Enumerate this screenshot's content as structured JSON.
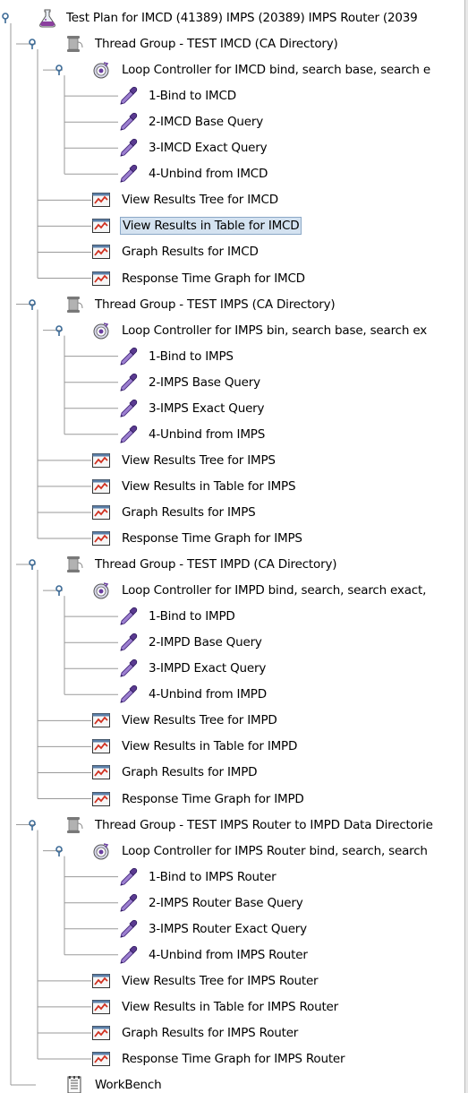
{
  "tree": {
    "root": {
      "label": "Test Plan for IMCD (41389) IMPS  (20389)  IMPS Router (2039",
      "icon": "flask-icon"
    },
    "groups": [
      {
        "label": "Thread Group - TEST IMCD (CA Directory)",
        "loop": "Loop Controller for IMCD bind, search base, search e",
        "samplers": [
          "1-Bind to IMCD",
          "2-IMCD Base Query",
          "3-IMCD Exact Query",
          "4-Unbind from IMCD"
        ],
        "listeners": [
          "View Results Tree for IMCD",
          "View Results in Table for IMCD",
          "Graph Results for IMCD",
          "Response Time Graph for IMCD"
        ]
      },
      {
        "label": "Thread Group - TEST IMPS (CA Directory)",
        "loop": "Loop Controller for IMPS bin, search base, search ex",
        "samplers": [
          "1-Bind to IMPS",
          "2-IMPS Base Query",
          "3-IMPS Exact Query",
          "4-Unbind from IMPS"
        ],
        "listeners": [
          "View Results Tree for IMPS",
          "View Results in Table for IMPS",
          "Graph Results for IMPS",
          "Response Time Graph for IMPS"
        ]
      },
      {
        "label": "Thread Group - TEST IMPD (CA Directory)",
        "loop": "Loop Controller for IMPD bind, search, search exact,",
        "samplers": [
          "1-Bind to IMPD",
          "2-IMPD Base Query",
          "3-IMPD Exact Query",
          "4-Unbind from IMPD"
        ],
        "listeners": [
          "View Results Tree for IMPD",
          "View Results in Table for IMPD",
          "Graph Results for IMPD",
          "Response Time Graph for IMPD"
        ]
      },
      {
        "label": "Thread Group - TEST IMPS Router to IMPD Data Directorie",
        "loop": "Loop Controller for IMPS Router bind, search, search",
        "samplers": [
          "1-Bind to IMPS Router",
          "2-IMPS Router Base Query",
          "3-IMPS Router Exact Query",
          "4-Unbind from IMPS Router"
        ],
        "listeners": [
          "View Results Tree for IMPS Router",
          "View Results in Table for IMPS Router",
          "Graph Results for IMPS Router",
          "Response Time Graph for IMPS Router"
        ]
      }
    ],
    "workbench": {
      "label": "WorkBench",
      "icon": "workbench-icon"
    },
    "selected": "View Results in Table for IMCD",
    "colors": {
      "selection_bg": "#d4e2f0",
      "selection_border": "#8ba8c7",
      "line": "#9a9a9a",
      "toggle": "#3c6a96",
      "listener_red": "#d03020",
      "sampler_purple": "#6a3fa0"
    }
  }
}
